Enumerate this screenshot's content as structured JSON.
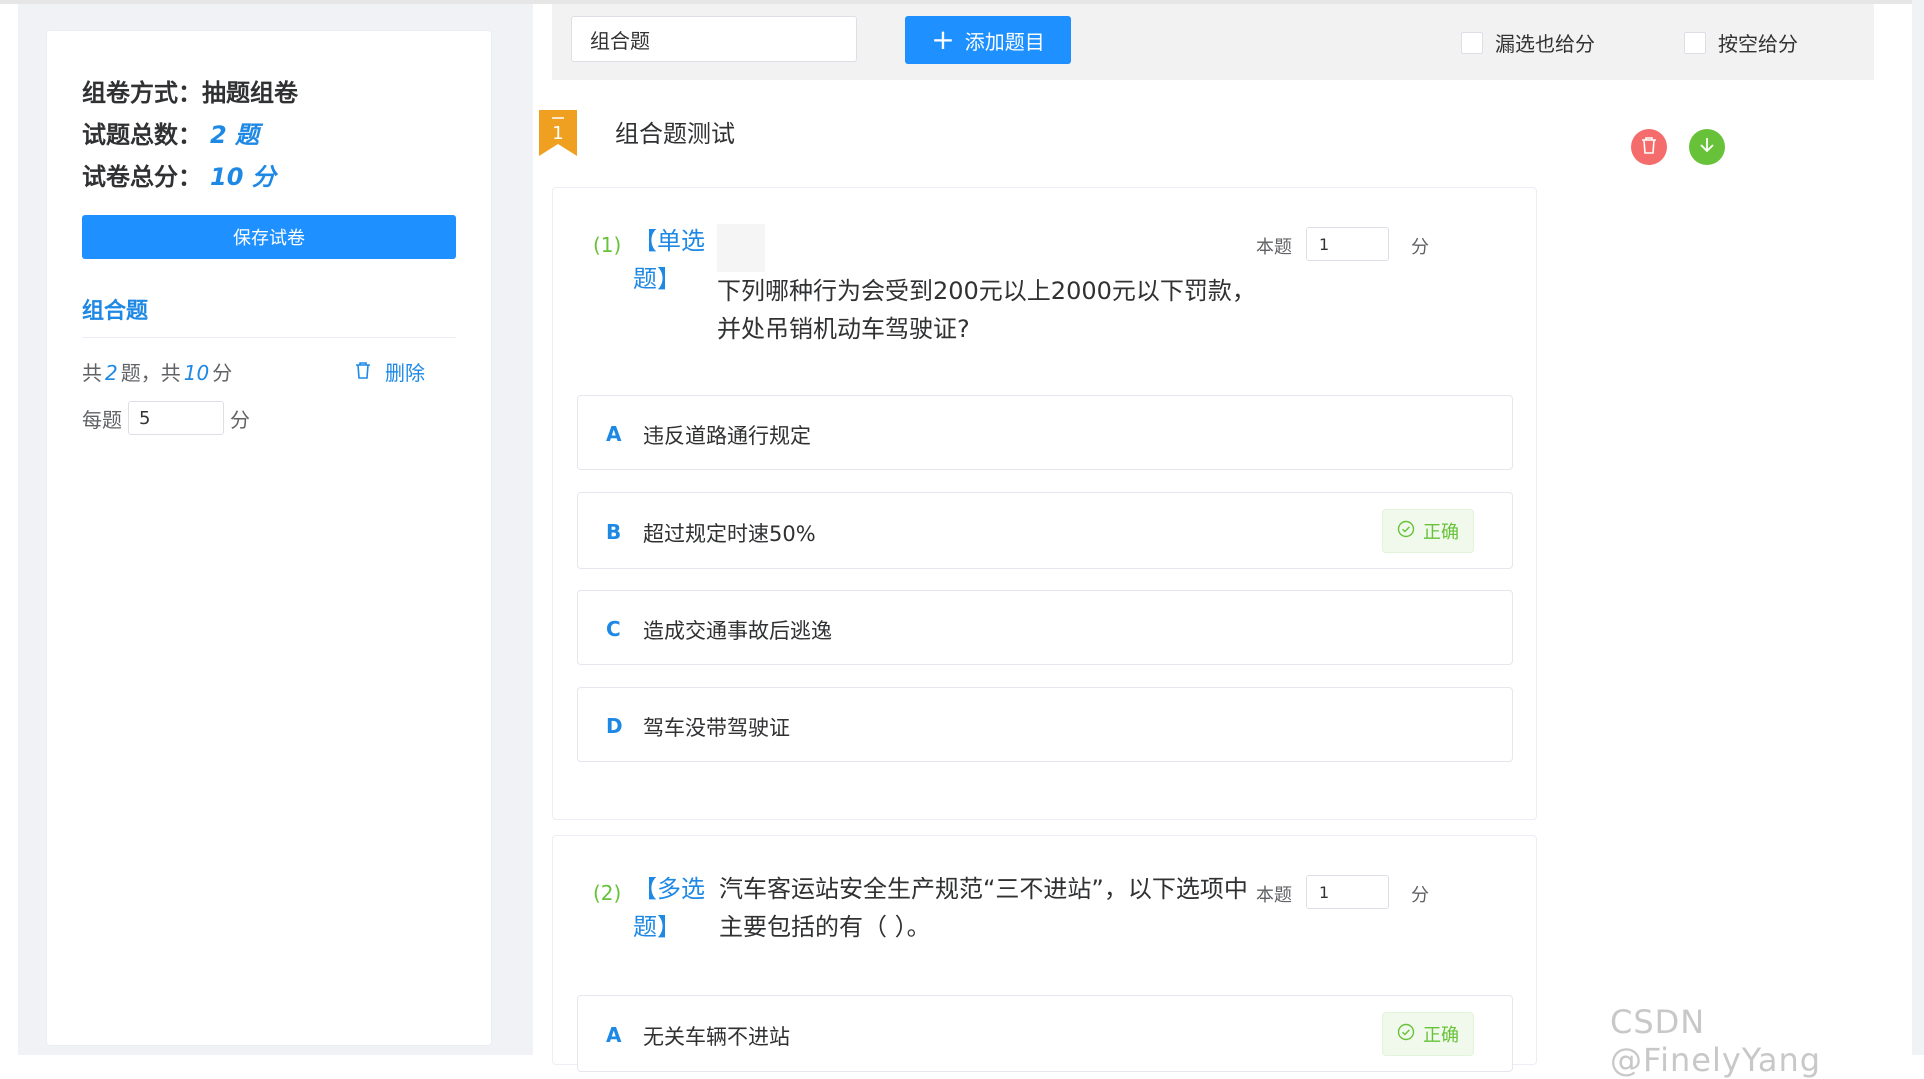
{
  "sidebar": {
    "method_label": "组卷方式：",
    "method_value": "抽题组卷",
    "total_label": "试题总数：",
    "total_value": "2 题",
    "score_label": "试卷总分：",
    "score_value": "10 分",
    "save_button": "保存试卷",
    "group_title": "组合题",
    "count_prefix": "共",
    "count_questions": "2",
    "count_mid": "题，共",
    "count_score": "10",
    "count_suffix": "分",
    "delete_label": "删除",
    "per_label": "每题",
    "per_value": "5",
    "per_unit": "分"
  },
  "toolbar": {
    "type_value": "组合题",
    "add_button": "添加题目",
    "plus_glyph": "+",
    "option1_label": "漏选也给分",
    "option2_label": "按空给分"
  },
  "section": {
    "number": "1",
    "title": "组合题测试"
  },
  "questions": [
    {
      "index": "(1)",
      "type_line1": "【单选",
      "type_line2": "题】",
      "text_line1": "下列哪种行为会受到200元以上2000元以下罚款，",
      "text_line2": "并处吊销机动车驾驶证?",
      "score_label": "本题",
      "score_value": "1",
      "score_unit": "分",
      "options": [
        {
          "letter": "A",
          "text": "违反道路通行规定",
          "correct": false
        },
        {
          "letter": "B",
          "text": "超过规定时速50%",
          "correct": true
        },
        {
          "letter": "C",
          "text": "造成交通事故后逃逸",
          "correct": false
        },
        {
          "letter": "D",
          "text": "驾车没带驾驶证",
          "correct": false
        }
      ]
    },
    {
      "index": "(2)",
      "type_line1": "【多选",
      "type_line2": "题】",
      "text_line1": "汽车客运站安全生产规范“三不进站”，以下选项中",
      "text_line2": "主要包括的有（ ）。",
      "score_label": "本题",
      "score_value": "1",
      "score_unit": "分",
      "options": [
        {
          "letter": "A",
          "text": "无关车辆不进站",
          "correct": true
        }
      ]
    }
  ],
  "correct_label": "正确",
  "watermark": "CSDN @FinelyYang"
}
